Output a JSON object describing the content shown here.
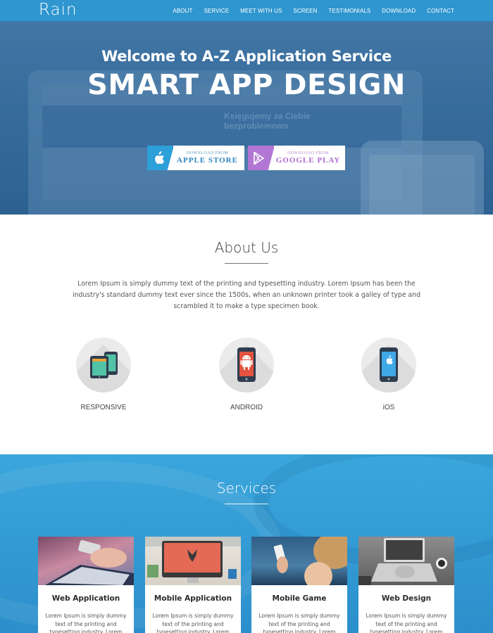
{
  "nav": {
    "brand": "Rain",
    "links": [
      "ABOUT",
      "SERVICE",
      "MEET WITH US",
      "SCREEN",
      "TESTIMONIALS",
      "DOWNLOAD",
      "CONTACT"
    ]
  },
  "hero": {
    "welcome": "Welcome to A-Z Application Service",
    "title": "SMART APP DESIGN",
    "mock_text": "Księgujemy za Ciebie bezproblemowo",
    "apple": {
      "small": "DOWNLOAD FROM",
      "big": "APPLE STORE",
      "icon": "apple-icon"
    },
    "google": {
      "small": "DOWNLOAD FROM",
      "big": "GOOGLE PLAY",
      "icon": "play-icon"
    }
  },
  "about": {
    "title": "About Us",
    "text": "Lorem Ipsum is simply dummy text of the printing and typesetting industry. Lorem Ipsum has been the industry's standard dummy text ever since the 1500s, when an unknown printer took a galley of type and scrambled it to make a type specimen book.",
    "features": [
      {
        "label": "RESPONSIVE",
        "icon": "responsive-devices-icon"
      },
      {
        "label": "ANDROID",
        "icon": "android-phone-icon"
      },
      {
        "label": "iOS",
        "icon": "ios-phone-icon"
      }
    ]
  },
  "services": {
    "title": "Services",
    "cards": [
      {
        "title": "Web Application",
        "text": "Lorem Ipsum is simply dummy text of the printing and typesetting industry. Lorem Ipsum"
      },
      {
        "title": "Mobile Application",
        "text": "Lorem Ipsum is simply dummy text of the printing and typesetting industry. Lorem Ipsum"
      },
      {
        "title": "Mobile Game",
        "text": "Lorem Ipsum is simply dummy text of the printing and typesetting industry. Lorem Ipsum"
      },
      {
        "title": "Web Design",
        "text": "Lorem Ipsum is simply dummy text of the printing and typesetting industry. Lorem Ipsum"
      }
    ]
  },
  "colors": {
    "nav": "#2f96cf",
    "apple_accent": "#2d9fd9",
    "google_accent": "#b277d4",
    "services_bg": "#3aa6dc"
  }
}
